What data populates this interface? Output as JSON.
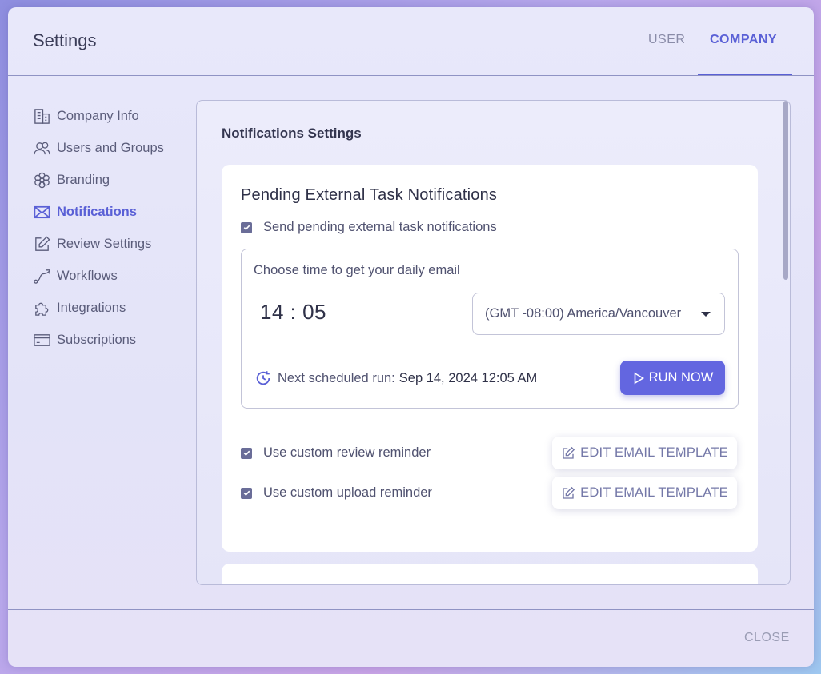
{
  "header": {
    "title": "Settings",
    "tabs": [
      {
        "label": "USER",
        "active": false
      },
      {
        "label": "COMPANY",
        "active": true
      }
    ]
  },
  "sidebar": {
    "items": [
      {
        "label": "Company Info",
        "icon": "building-icon",
        "active": false
      },
      {
        "label": "Users and Groups",
        "icon": "users-icon",
        "active": false
      },
      {
        "label": "Branding",
        "icon": "flower-icon",
        "active": false
      },
      {
        "label": "Notifications",
        "icon": "mail-icon",
        "active": true
      },
      {
        "label": "Review Settings",
        "icon": "edit-icon",
        "active": false
      },
      {
        "label": "Workflows",
        "icon": "workflow-icon",
        "active": false
      },
      {
        "label": "Integrations",
        "icon": "puzzle-icon",
        "active": false
      },
      {
        "label": "Subscriptions",
        "icon": "card-icon",
        "active": false
      }
    ]
  },
  "main": {
    "section_title": "Notifications Settings",
    "card": {
      "title": "Pending External Task Notifications",
      "send_notifications": {
        "label": "Send pending external task notifications",
        "checked": true
      },
      "schedule": {
        "choose_label": "Choose time to get your daily email",
        "time": "14 : 05",
        "timezone": "(GMT -08:00) America/Vancouver",
        "next_run_label": "Next scheduled run:",
        "next_run_value": "Sep 14, 2024 12:05 AM",
        "run_now_label": "RUN NOW"
      },
      "review_reminder": {
        "label": "Use custom review reminder",
        "checked": true,
        "button_label": "EDIT EMAIL TEMPLATE"
      },
      "upload_reminder": {
        "label": "Use custom upload reminder",
        "checked": true,
        "button_label": "EDIT EMAIL TEMPLATE"
      }
    }
  },
  "footer": {
    "close_label": "CLOSE"
  },
  "colors": {
    "accent": "#5a60d6",
    "button": "#6366e0",
    "text": "#505270"
  }
}
